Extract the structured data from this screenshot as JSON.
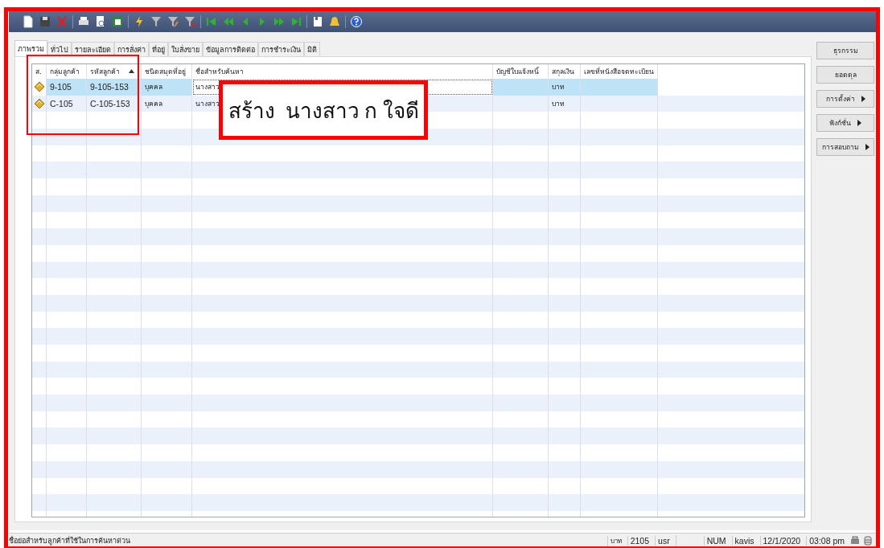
{
  "tabs": [
    {
      "label": "ภาพรวม",
      "selected": true
    },
    {
      "label": "ทั่วไป",
      "selected": false
    },
    {
      "label": "รายละเอียด",
      "selected": false
    },
    {
      "label": "การสั่งค่า",
      "selected": false
    },
    {
      "label": "ที่อยู่",
      "selected": false
    },
    {
      "label": "ใบสั่งขาย",
      "selected": false
    },
    {
      "label": "ข้อมูลการติดต่อ",
      "selected": false
    },
    {
      "label": "การชำระเงิน",
      "selected": false
    },
    {
      "label": "มิติ",
      "selected": false
    }
  ],
  "table": {
    "columns": [
      {
        "label": "ส.",
        "sorted": false
      },
      {
        "label": "กลุ่มลูกค้า",
        "sorted": false
      },
      {
        "label": "รหัสลูกค้า",
        "sorted": true
      },
      {
        "label": "ชนิดสมุดที่อยู่",
        "sorted": false
      },
      {
        "label": "ชื่อสำหรับค้นหา",
        "sorted": false
      },
      {
        "label": "บัญชีใบแจ้งหนี้",
        "sorted": false
      },
      {
        "label": "สกุลเงิน",
        "sorted": false
      },
      {
        "label": "เลขที่หนังสือจดทะเบียน",
        "sorted": false
      }
    ],
    "rows": [
      {
        "selected": true,
        "group": "9-105",
        "code": "9-105-153",
        "address_type": "บุคคล",
        "search_name": "นางสาว",
        "currency": "บาท"
      },
      {
        "selected": false,
        "group": "C-105",
        "code": "C-105-153",
        "address_type": "บุคคล",
        "search_name": "นางสาว",
        "currency": "บาท"
      }
    ]
  },
  "side_buttons": [
    {
      "label": "ธุรกรรม",
      "submenu": false
    },
    {
      "label": "ยอดดุล",
      "submenu": false
    },
    {
      "label": "การตั้งค่า",
      "submenu": true
    },
    {
      "label": "ฟังก์ชั่น",
      "submenu": true
    },
    {
      "label": "การสอบถาม",
      "submenu": true
    }
  ],
  "callout": {
    "text": "สร้าง  นางสาว ก ใจดี"
  },
  "status_bar": {
    "message": "ชื่อย่อสำหรับลูกค้าที่ใช้ในการค้นหาด่วน",
    "fields": [
      "บาท",
      "2105",
      "usr",
      "NUM",
      "kavis",
      "12/1/2020",
      "03:08 pm"
    ]
  }
}
